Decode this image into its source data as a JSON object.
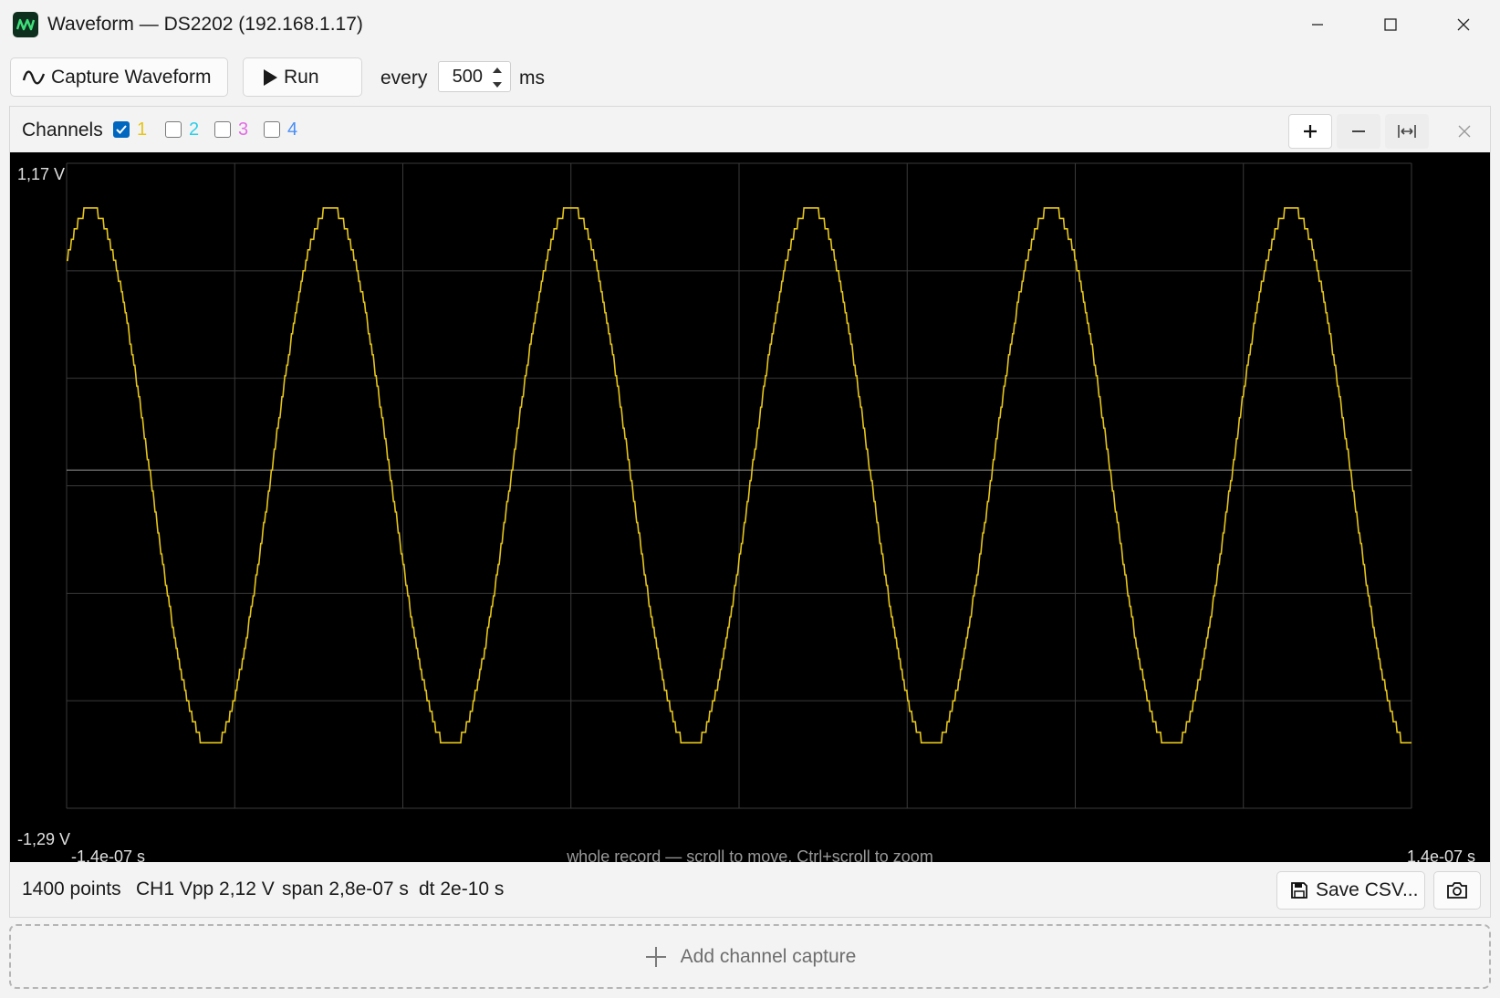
{
  "window": {
    "title": "Waveform — DS2202 (192.168.1.17)",
    "icon": "waveform-app-icon"
  },
  "toolbar": {
    "capture_label": "Capture Waveform",
    "run_label": "Run",
    "every_label": "every",
    "interval_value": "500",
    "ms_label": "ms"
  },
  "channels": {
    "label": "Channels",
    "items": [
      {
        "num": "1",
        "checked": true,
        "color": "#e6c619"
      },
      {
        "num": "2",
        "checked": false,
        "color": "#2bd0e8"
      },
      {
        "num": "3",
        "checked": false,
        "color": "#e36be6"
      },
      {
        "num": "4",
        "checked": false,
        "color": "#4a8ef5"
      }
    ]
  },
  "plot": {
    "y_top": "1,17 V",
    "y_bottom": "-1,29 V",
    "x_left": "-1,4e-07 s",
    "x_right": "1,4e-07 s",
    "hint": "whole record — scroll to move, Ctrl+scroll to zoom"
  },
  "chart_data": {
    "type": "line",
    "xlim": [
      -1.4e-07,
      1.4e-07
    ],
    "ylim": [
      -1.29,
      1.17
    ],
    "grid": true,
    "reference_level": 0,
    "series": [
      {
        "color": "#e6c619",
        "amplitude": 1.03,
        "offset": -0.03,
        "period": 5e-08,
        "peak_time": -1.35e-07,
        "points": 1400
      }
    ]
  },
  "status": {
    "points": "1400 points",
    "vpp": "CH1 Vpp 2,12 V",
    "span": "span 2,8e-07 s",
    "dt": "dt 2e-10 s",
    "save_label": "Save CSV..."
  },
  "add_capture_label": "Add channel capture",
  "colors": {
    "trace": "#e6c619",
    "plot_bg": "#000000",
    "grid": "#3a3a3a",
    "accent": "#0067c0"
  }
}
